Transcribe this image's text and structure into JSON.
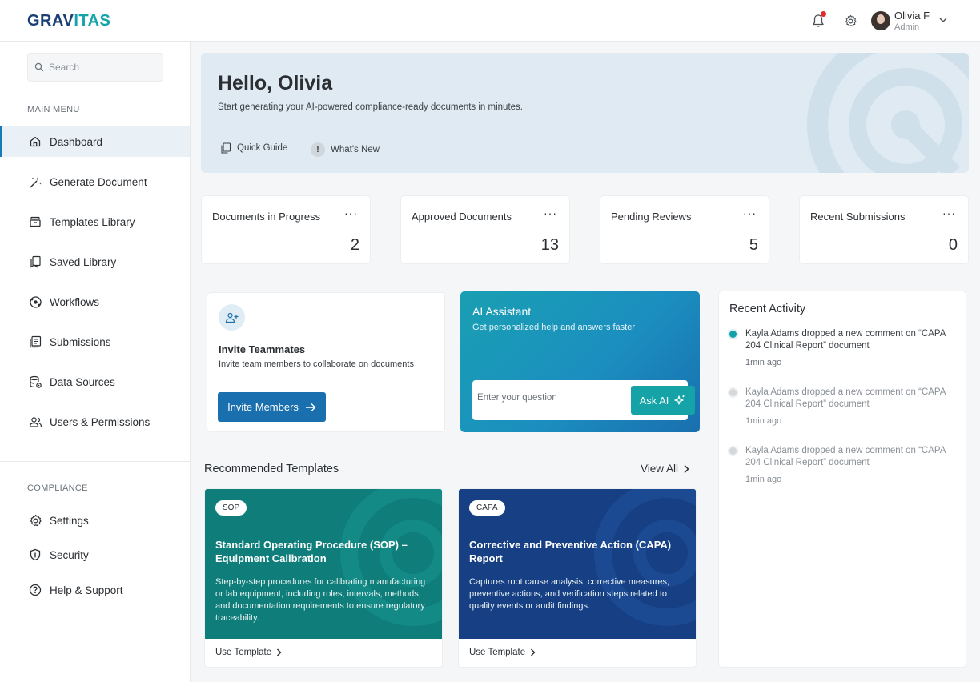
{
  "app": {
    "logo_prefix": "GRAV",
    "logo_accent": "ITAS"
  },
  "header": {
    "user_name": "Olivia F",
    "user_role": "Admin"
  },
  "sidebar": {
    "search_placeholder": "Search",
    "main_menu_label": "MAIN MENU",
    "main_items": [
      {
        "label": "Dashboard",
        "icon": "home-icon",
        "active": true
      },
      {
        "label": "Generate Document",
        "icon": "magic-wand-icon"
      },
      {
        "label": "Templates Library",
        "icon": "archive-icon"
      },
      {
        "label": "Saved Library",
        "icon": "bookmark-icon"
      },
      {
        "label": "Workflows",
        "icon": "workflow-icon"
      },
      {
        "label": "Submissions",
        "icon": "submissions-icon"
      },
      {
        "label": "Data Sources",
        "icon": "database-icon"
      },
      {
        "label": "Users & Permissions",
        "icon": "users-icon"
      }
    ],
    "compliance_label": "COMPLIANCE",
    "compliance_items": [
      {
        "label": "Settings",
        "icon": "gear-icon"
      },
      {
        "label": "Security",
        "icon": "shield-icon"
      },
      {
        "label": "Help & Support",
        "icon": "help-icon"
      }
    ]
  },
  "hero": {
    "greeting": "Hello, Olivia",
    "subtitle": "Start generating your AI-powered compliance-ready documents in minutes.",
    "quick_guide": "Quick Guide",
    "whats_new": "What's New",
    "whats_new_icon": "!"
  },
  "stats": [
    {
      "label": "Documents in Progress",
      "value": "2"
    },
    {
      "label": "Approved Documents",
      "value": "13"
    },
    {
      "label": "Pending Reviews",
      "value": "5"
    },
    {
      "label": "Recent Submissions",
      "value": "0"
    }
  ],
  "stats_menu": "···",
  "invite": {
    "title": "Invite Teammates",
    "description": "Invite team members to collaborate on documents",
    "button_label": "Invite Members"
  },
  "ai_assistant": {
    "title": "AI Assistant",
    "description": "Get personalized help and answers faster",
    "input_placeholder": "Enter your question",
    "button_label": "Ask AI"
  },
  "recommended": {
    "title": "Recommended Templates",
    "view_all": "View All",
    "templates": [
      {
        "tag": "SOP",
        "title": "Standard Operating Procedure (SOP) – Equipment Calibration",
        "description": "Step-by-step procedures for calibrating manufacturing or lab equipment, including roles, intervals, methods, and documentation requirements to ensure regulatory traceability.",
        "action": "Use Template",
        "color": "#0f7e7a"
      },
      {
        "tag": "CAPA",
        "title": "Corrective and Preventive Action (CAPA) Report",
        "description": "Captures root cause analysis, corrective measures, preventive actions, and verification steps related to quality events or audit findings.",
        "action": "Use Template",
        "color": "#163f84"
      }
    ]
  },
  "activity": {
    "title": "Recent Activity",
    "items": [
      {
        "text": "Kayla Adams dropped a new comment on “CAPA 204 Clinical Report” document",
        "time": "1min ago",
        "unread": true
      },
      {
        "text": "Kayla Adams dropped a new comment on “CAPA 204 Clinical Report” document",
        "time": "1min ago",
        "unread": false
      },
      {
        "text": "Kayla Adams dropped a new comment on “CAPA 204 Clinical Report” document",
        "time": "1min ago",
        "unread": false
      }
    ]
  },
  "colors": {
    "brand_navy": "#1b3f75",
    "brand_teal": "#12a4a9",
    "primary_button": "#1a6fae",
    "notification_dot": "#e52a2a"
  }
}
